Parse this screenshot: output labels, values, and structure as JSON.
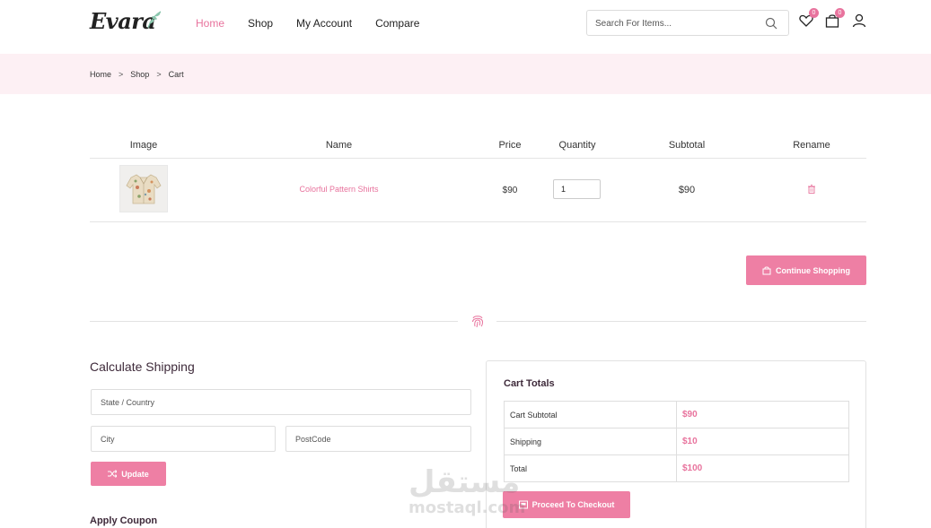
{
  "brand": {
    "logo_text": "Evara"
  },
  "nav": {
    "items": [
      {
        "label": "Home",
        "active": true
      },
      {
        "label": "Shop",
        "active": false
      },
      {
        "label": "My Account",
        "active": false
      },
      {
        "label": "Compare",
        "active": false
      }
    ]
  },
  "search": {
    "placeholder": "Search For Items..."
  },
  "header_icons": {
    "wishlist_count": "0",
    "cart_count": "0"
  },
  "breadcrumb": [
    "Home",
    "Shop",
    "Cart"
  ],
  "breadcrumb_separator": ">",
  "cart_table": {
    "headers": [
      "Image",
      "Name",
      "Price",
      "Quantity",
      "Subtotal",
      "Rename"
    ],
    "rows": [
      {
        "name": "Colorful Pattern Shirts",
        "price": "$90",
        "quantity": "1",
        "subtotal": "$90"
      }
    ]
  },
  "continue_shopping_label": "Continue Shopping",
  "shipping": {
    "title": "Calculate Shipping",
    "state_placeholder": "State / Country",
    "city_placeholder": "City",
    "postcode_placeholder": "PostCode",
    "update_label": "Update"
  },
  "coupon": {
    "title": "Apply Coupon"
  },
  "totals": {
    "title": "Cart Totals",
    "rows": [
      {
        "label": "Cart Subtotal",
        "value": "$90"
      },
      {
        "label": "Shipping",
        "value": "$10"
      },
      {
        "label": "Total",
        "value": "$100"
      }
    ],
    "checkout_label": "Proceed To Checkout"
  },
  "watermark": {
    "arabic": "مستقل",
    "latin": "mostaql.com"
  },
  "colors": {
    "accent": "#e8739d",
    "button": "#ee7fa4",
    "breadcrumb_bg": "#fdf0f4"
  }
}
